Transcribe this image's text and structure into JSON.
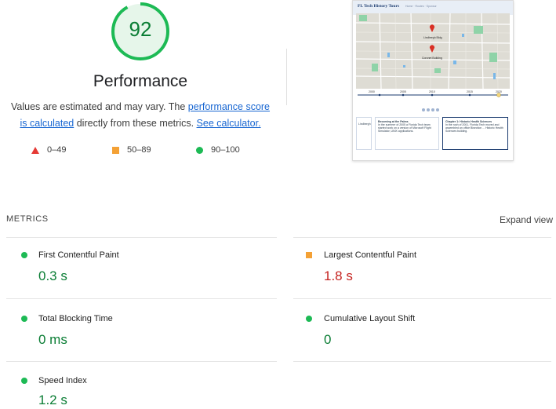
{
  "score": {
    "value": "92",
    "fraction": 0.92,
    "title": "Performance",
    "desc_prefix": "Values are estimated and may vary. The ",
    "desc_link1": "performance score is calculated",
    "desc_mid": " directly from these metrics. ",
    "desc_link2": "See calculator."
  },
  "legend": [
    {
      "icon": "triangle",
      "range": "0–49",
      "color": "#e53935"
    },
    {
      "icon": "square",
      "range": "50–89",
      "color": "#f4a135"
    },
    {
      "icon": "circle",
      "range": "90–100",
      "color": "#1dba55"
    }
  ],
  "screenshot": {
    "site_title": "FL Tech History Tours",
    "nav": "Home · Routes · Sponsor",
    "map_labels": [
      "Lindbergh Bldg",
      "Coronet Building"
    ],
    "timeline": [
      "2000",
      "2005",
      "2010",
      "2015",
      "2020"
    ],
    "card1_title": "Becoming at the Palms",
    "card1_body": "In the summer of 2005 a Florida Tech team started work on a version of Microsoft Flight Simulator, UNIX applications.",
    "card2_title": "Chapter 1: Historic Health Sciences",
    "card2_body": "In the rush of 2001, Florida Tech moved and assembled an office Bisection ... Historic Health Sciences building.",
    "left_label": "Lindbergh"
  },
  "metrics": {
    "heading": "METRICS",
    "expand": "Expand view",
    "items": [
      {
        "label": "First Contentful Paint",
        "value": "0.3 s",
        "status": "pass"
      },
      {
        "label": "Largest Contentful Paint",
        "value": "1.8 s",
        "status": "average"
      },
      {
        "label": "Total Blocking Time",
        "value": "0 ms",
        "status": "pass"
      },
      {
        "label": "Cumulative Layout Shift",
        "value": "0",
        "status": "pass"
      },
      {
        "label": "Speed Index",
        "value": "1.2 s",
        "status": "pass"
      }
    ]
  },
  "colors": {
    "pass": "#0a7d34",
    "average": "#c5221f",
    "gauge": "#1dba55",
    "link": "#1967d2"
  }
}
